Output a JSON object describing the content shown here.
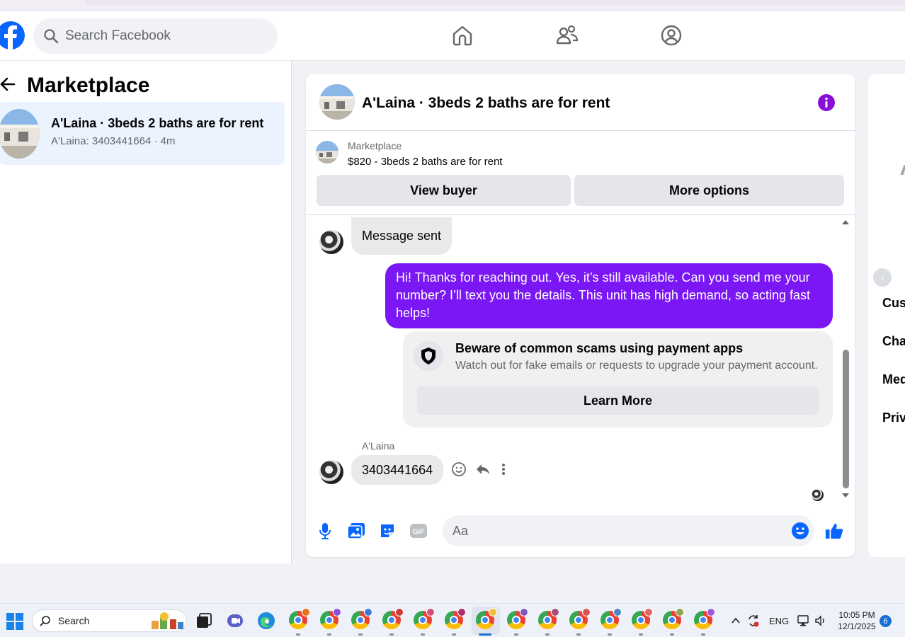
{
  "header": {
    "search_placeholder": "Search Facebook",
    "nav": [
      "home-icon",
      "friends-icon",
      "profile-icon"
    ],
    "brand_color": "#0866ff"
  },
  "sidebar": {
    "title": "Marketplace",
    "conversation": {
      "title": "A'Laina · 3beds 2 baths are for rent",
      "subtitle": "A'Laina: 3403441664 · 4m"
    }
  },
  "chat": {
    "title": "A'Laina · 3beds 2 baths are for rent",
    "accent": "#7a17f4",
    "product": {
      "label": "Marketplace",
      "price_line": "$820 - 3beds 2 baths are for rent",
      "view_buyer": "View buyer",
      "more_options": "More options"
    },
    "messages": {
      "first_in": "Message sent",
      "out": "Hi! Thanks for reaching out. Yes, it’s still available. Can you send me your number? I’ll text you the details. This unit has high demand, so acting fast helps!",
      "warning_title": "Beware of common scams using payment apps",
      "warning_sub": "Watch out for fake emails or requests to upgrade your payment account.",
      "learn_more": "Learn More",
      "sender": "A'Laina",
      "last_in": "3403441664"
    },
    "composer": {
      "placeholder": "Aa"
    }
  },
  "right_panel": {
    "items": [
      "Cust",
      "Cha",
      "Med",
      "Priv"
    ]
  },
  "taskbar": {
    "search_label": "Search",
    "language": "ENG",
    "time": "10:05 PM",
    "date": "12/1/2025",
    "notification_count": "6"
  }
}
